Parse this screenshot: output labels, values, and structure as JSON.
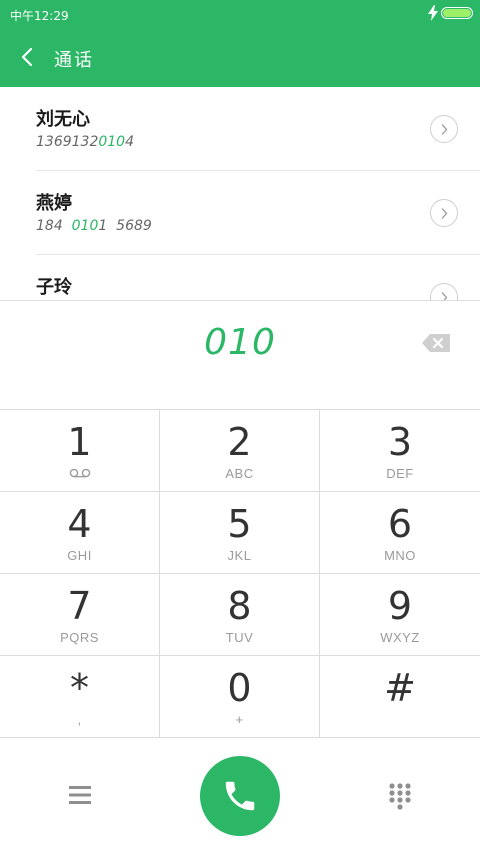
{
  "status_bar": {
    "time": "中午12:29"
  },
  "header": {
    "title": "通话"
  },
  "contacts": [
    {
      "name": "刘无心",
      "number_pre": "1369132",
      "number_match": "010",
      "number_post": "4"
    },
    {
      "name": "燕婷",
      "number_pre": "184  ",
      "number_match": "010",
      "number_post": "1  5689"
    },
    {
      "name": "子玲",
      "number_pre": "",
      "number_match": "",
      "number_post": ""
    }
  ],
  "dialer": {
    "input": "010"
  },
  "keypad": [
    {
      "digit": "1",
      "letters": ""
    },
    {
      "digit": "2",
      "letters": "ABC"
    },
    {
      "digit": "3",
      "letters": "DEF"
    },
    {
      "digit": "4",
      "letters": "GHI"
    },
    {
      "digit": "5",
      "letters": "JKL"
    },
    {
      "digit": "6",
      "letters": "MNO"
    },
    {
      "digit": "7",
      "letters": "PQRS"
    },
    {
      "digit": "8",
      "letters": "TUV"
    },
    {
      "digit": "9",
      "letters": "WXYZ"
    },
    {
      "digit": "*",
      "letters": ","
    },
    {
      "digit": "0",
      "letters": "+"
    },
    {
      "digit": "#",
      "letters": ""
    }
  ],
  "colors": {
    "accent": "#2bb766",
    "battery": "#9ef06a"
  },
  "icons": {
    "back": "back-arrow-icon",
    "charging": "charging-bolt-icon",
    "chevron": "chevron-right-icon",
    "backspace": "backspace-icon",
    "voicemail": "voicemail-icon",
    "menu": "menu-icon",
    "call": "phone-icon",
    "dialpad": "dialpad-icon"
  }
}
